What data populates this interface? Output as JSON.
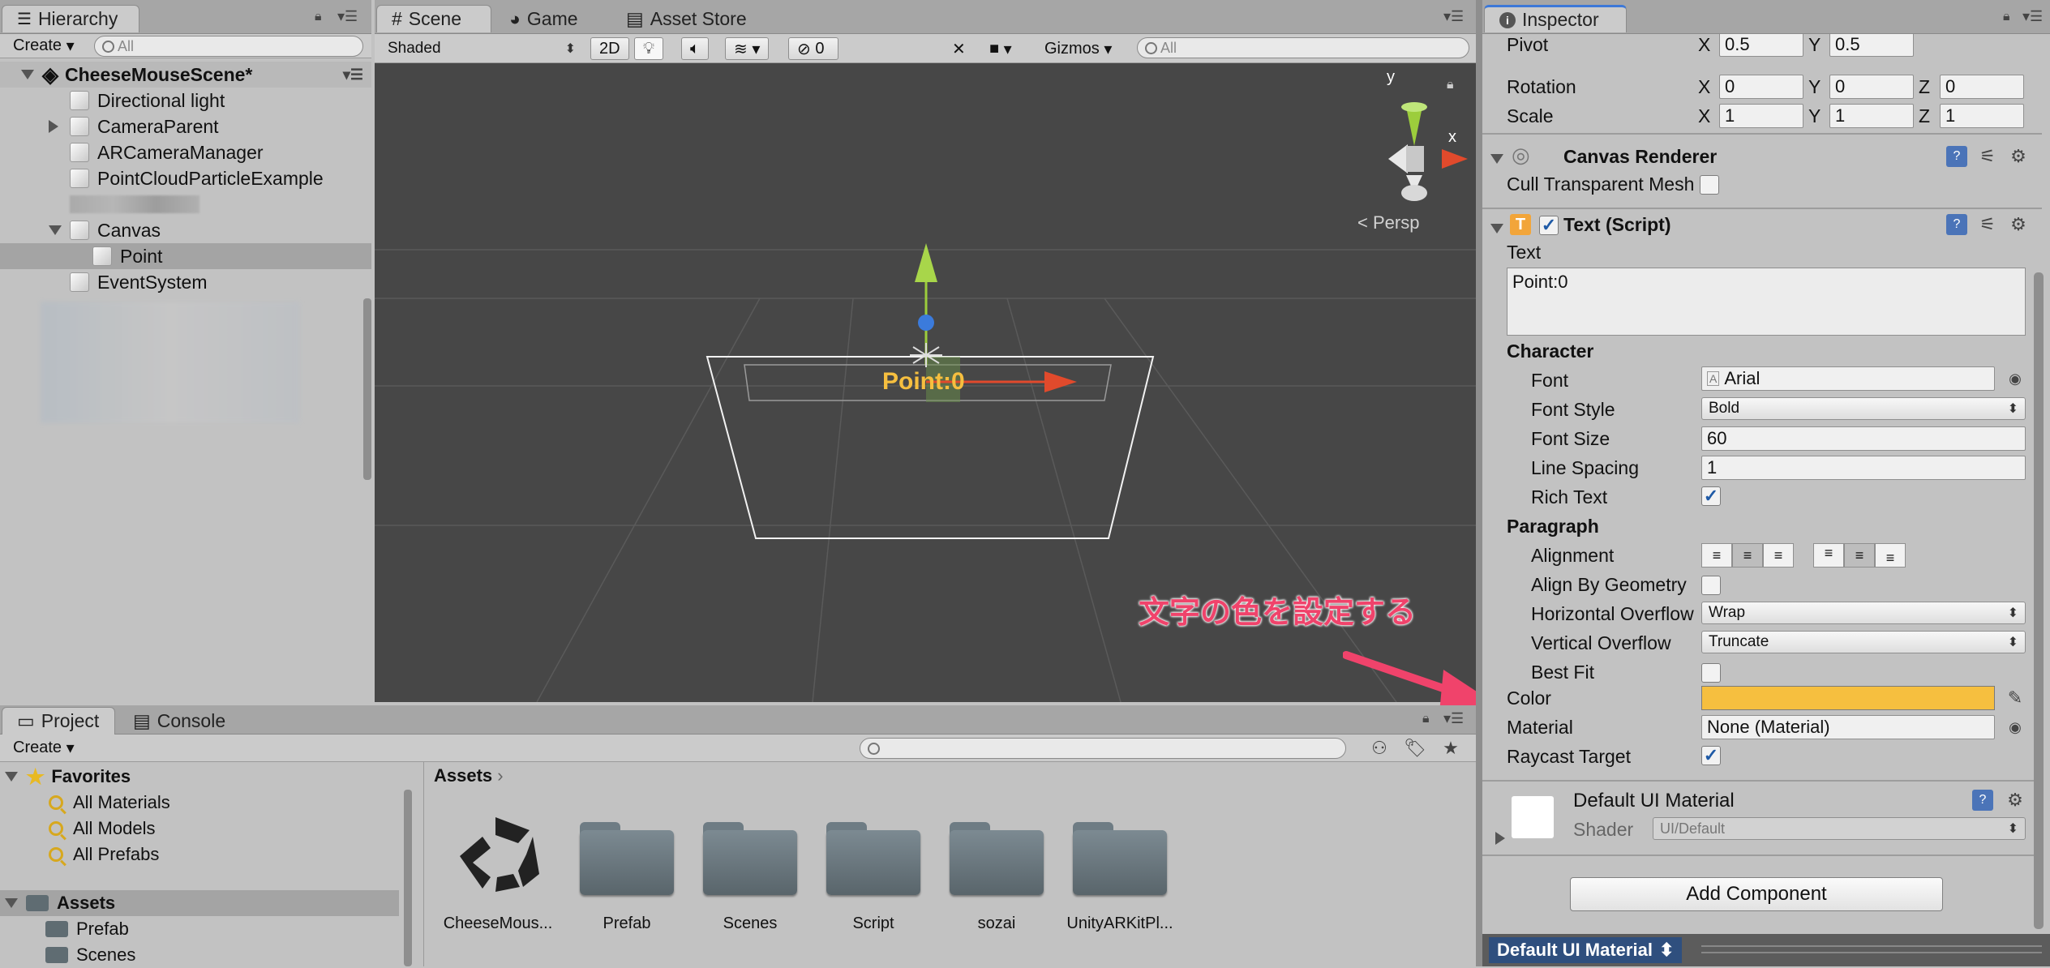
{
  "hierarchy": {
    "tab_label": "Hierarchy",
    "create_label": "Create",
    "search_placeholder": "All",
    "scene_name": "CheeseMouseScene*",
    "items": [
      {
        "label": "Directional light"
      },
      {
        "label": "CameraParent"
      },
      {
        "label": "ARCameraManager"
      },
      {
        "label": "PointCloudParticleExample"
      },
      {
        "label": ""
      },
      {
        "label": "Canvas"
      },
      {
        "label": "Point"
      },
      {
        "label": "EventSystem"
      }
    ]
  },
  "scene_view": {
    "tabs": [
      {
        "label": "Scene"
      },
      {
        "label": "Game"
      },
      {
        "label": "Asset Store"
      }
    ],
    "shading_mode": "Shaded",
    "mode_2d_label": "2D",
    "hidden_count": "0",
    "gizmos_label": "Gizmos",
    "search_placeholder": "All",
    "persp_label": "< Persp",
    "axis_y": "y",
    "axis_x": "x",
    "canvas_text": "Point:0",
    "annotation_text": "文字の色を設定する",
    "annotation_color": "#f0436b",
    "background_color": "#474747"
  },
  "inspector": {
    "tab_label": "Inspector",
    "pivot": {
      "label": "Pivot",
      "x_label": "X",
      "y_label": "Y",
      "x": "0.5",
      "y": "0.5"
    },
    "rotation": {
      "label": "Rotation",
      "x_label": "X",
      "y_label": "Y",
      "z_label": "Z",
      "x": "0",
      "y": "0",
      "z": "0"
    },
    "scale": {
      "label": "Scale",
      "x_label": "X",
      "y_label": "Y",
      "z_label": "Z",
      "x": "1",
      "y": "1",
      "z": "1"
    },
    "canvas_renderer": {
      "title": "Canvas Renderer",
      "cull_label": "Cull Transparent Mesh",
      "cull_checked": false
    },
    "text_script": {
      "title": "Text (Script)",
      "enabled": true,
      "text_label": "Text",
      "text_value": "Point:0",
      "character_header": "Character",
      "font_label": "Font",
      "font_value": "Arial",
      "font_style_label": "Font Style",
      "font_style_value": "Bold",
      "font_size_label": "Font Size",
      "font_size_value": "60",
      "line_spacing_label": "Line Spacing",
      "line_spacing_value": "1",
      "rich_text_label": "Rich Text",
      "rich_text_checked": true,
      "paragraph_header": "Paragraph",
      "alignment_label": "Alignment",
      "align_by_geometry_label": "Align By Geometry",
      "align_by_geometry_checked": false,
      "horizontal_overflow_label": "Horizontal Overflow",
      "horizontal_overflow_value": "Wrap",
      "vertical_overflow_label": "Vertical Overflow",
      "vertical_overflow_value": "Truncate",
      "best_fit_label": "Best Fit",
      "best_fit_checked": false,
      "color_label": "Color",
      "color_value": "#f6bf3f",
      "material_label": "Material",
      "material_value": "None (Material)",
      "raycast_label": "Raycast Target",
      "raycast_checked": true
    },
    "material_block": {
      "title": "Default UI Material",
      "shader_label": "Shader",
      "shader_value": "UI/Default"
    },
    "add_component_label": "Add Component",
    "footer_label": "Default UI Material"
  },
  "project": {
    "tabs": [
      {
        "label": "Project"
      },
      {
        "label": "Console"
      }
    ],
    "create_label": "Create",
    "favorites_label": "Favorites",
    "favorites": [
      {
        "label": "All Materials"
      },
      {
        "label": "All Models"
      },
      {
        "label": "All Prefabs"
      }
    ],
    "assets_root_label": "Assets",
    "asset_folders_tree": [
      {
        "label": "Prefab"
      },
      {
        "label": "Scenes"
      }
    ],
    "breadcrumb": "Assets",
    "assets": [
      {
        "label": "CheeseMous..."
      },
      {
        "label": "Prefab"
      },
      {
        "label": "Scenes"
      },
      {
        "label": "Script"
      },
      {
        "label": "sozai"
      },
      {
        "label": "UnityARKitPl..."
      }
    ]
  }
}
